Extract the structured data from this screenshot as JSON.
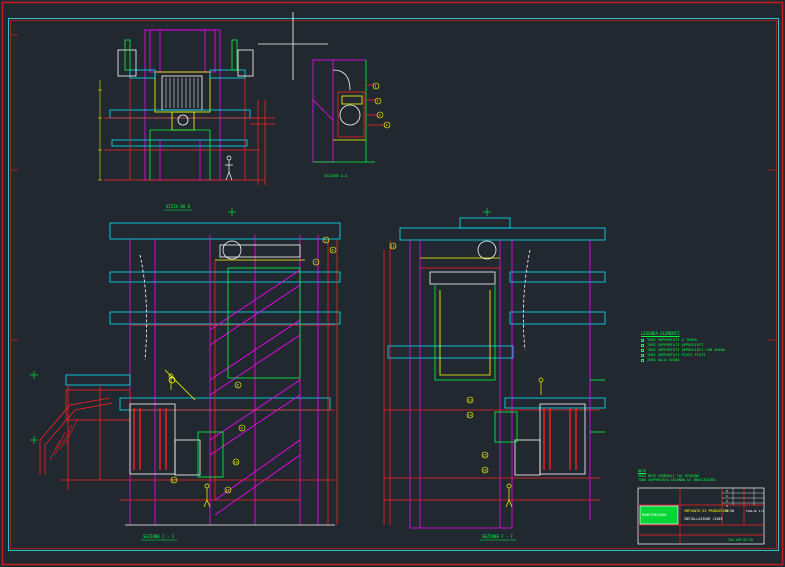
{
  "app": {
    "background": "#212830",
    "colors": {
      "frame": "#c31d1d",
      "inner_frame": "#2fc0c8",
      "magenta": "#ff00ff",
      "red": "#ff2020",
      "green": "#00ff3c",
      "yellow": "#ffff00",
      "cyan": "#00e5ff",
      "white": "#ffffff",
      "orange": "#ff8a00"
    }
  },
  "views": {
    "top_left": "VISTA DA O",
    "top_middle": "SEZIONE A-A",
    "bottom_left": "SEZIONE C - C",
    "bottom_right": "SEZIONE F - F"
  },
  "legend": {
    "title": "LEGENDA ELEMENTI",
    "items": [
      "TUBI SUPPORTATI A TERRA",
      "TUBI SUPPORTATI APPOGGIATI",
      "TUBI SUPPORTATI APPOGGIATI CON GUIDA",
      "TUBI SUPPORTATI FISSI FISSI",
      "TUBI ALLA GUIDA"
    ]
  },
  "notes": {
    "title": "NOTE",
    "lines": [
      "VEDI NOTE GENERALI SUL DISEGNO",
      "TUBO SUPPORTATO SECONDO LE INDICAZIONI"
    ]
  },
  "title_block": {
    "company": "MANUTENZIONE",
    "project": "IMPIANTO DI PRODUZIONE",
    "drawing_title": "INSTALLAZIONE LINEE",
    "scale": "1:50",
    "sheet": "FOGLIO 1/1",
    "drawing_no": "TAV-VAP-07-05",
    "revisions": [
      "0",
      "1",
      "2",
      "3"
    ]
  },
  "callouts": [
    "1",
    "2",
    "3",
    "4",
    "5",
    "6",
    "7",
    "8",
    "9",
    "10",
    "11",
    "12",
    "13",
    "14",
    "15",
    "16",
    "17"
  ]
}
